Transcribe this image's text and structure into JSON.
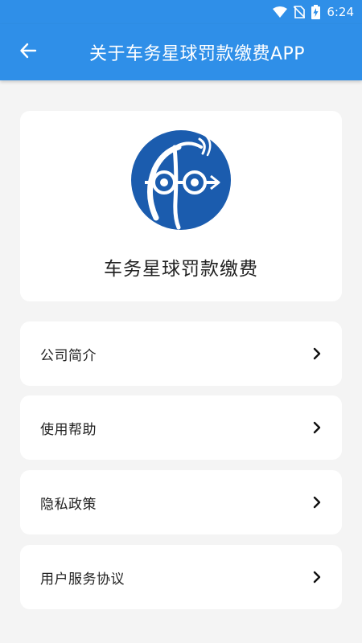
{
  "status_bar": {
    "time": "6:24",
    "icons": [
      "wifi-icon",
      "no-sim-icon",
      "battery-charging-icon"
    ]
  },
  "app_bar": {
    "title": "关于车务星球罚款缴费APP",
    "back_icon": "arrow-left-icon"
  },
  "about": {
    "app_name": "车务星球罚款缴费",
    "logo_icon": "app-logo"
  },
  "menu": {
    "items": [
      {
        "label": "公司简介",
        "icon": "chevron-right-icon"
      },
      {
        "label": "使用帮助",
        "icon": "chevron-right-icon"
      },
      {
        "label": "隐私政策",
        "icon": "chevron-right-icon"
      },
      {
        "label": "用户服务协议",
        "icon": "chevron-right-icon"
      }
    ]
  },
  "colors": {
    "primary": "#2f8fe8",
    "background": "#f4f4f4",
    "card": "#ffffff",
    "logo_blue": "#1b5cae"
  }
}
